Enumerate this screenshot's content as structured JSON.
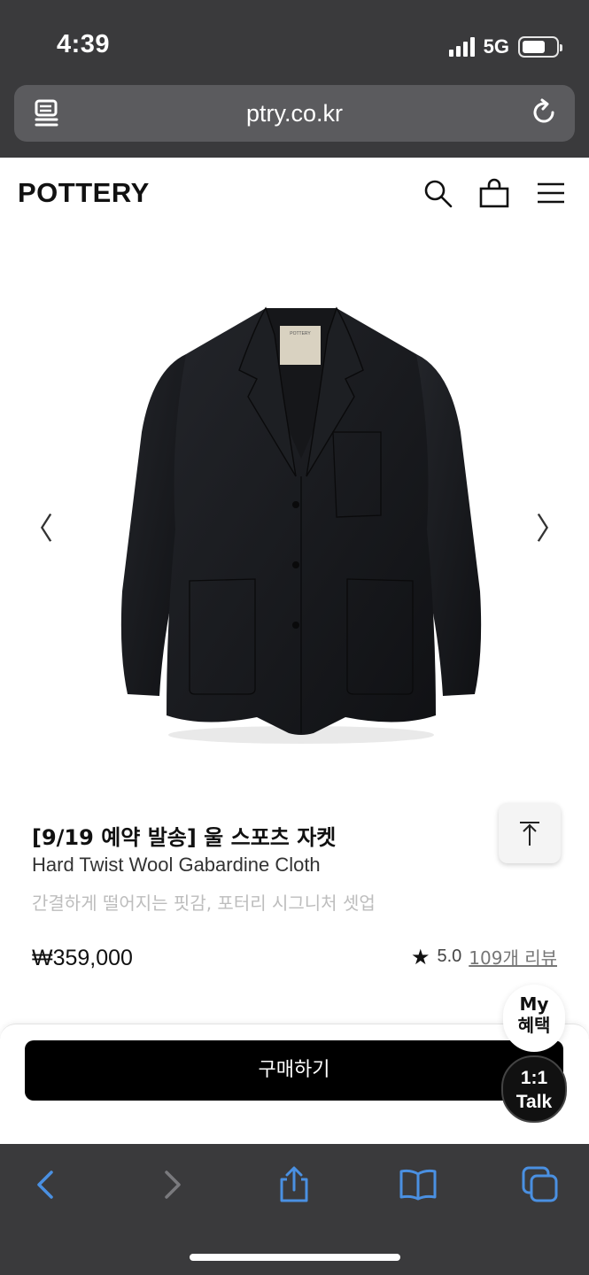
{
  "status_bar": {
    "time": "4:39",
    "network": "5G",
    "battery_level": 0.7
  },
  "browser": {
    "url": "ptry.co.kr"
  },
  "site": {
    "logo": "POTTERY"
  },
  "product": {
    "title": "[9/19 예약 발송] 울 스포츠 자켓",
    "subtitle": "Hard Twist Wool Gabardine Cloth",
    "description": "간결하게 떨어지는 핏감, 포터리 시그니처 셋업",
    "price": "₩359,000",
    "rating": "5.0",
    "reviews_link": "109개 리뷰",
    "label_text": "POTTERY"
  },
  "gallery": {
    "prev_arrow": "〈",
    "next_arrow": "〉"
  },
  "buy": {
    "button_label": "구매하기"
  },
  "floating": {
    "my_line1": "My",
    "my_line2": "혜택",
    "talk_line1": "1:1",
    "talk_line2": "Talk"
  },
  "colors": {
    "browser_chrome": "#3a3a3c",
    "toolbar_accent": "#4a90e2",
    "primary_button": "#000000"
  }
}
